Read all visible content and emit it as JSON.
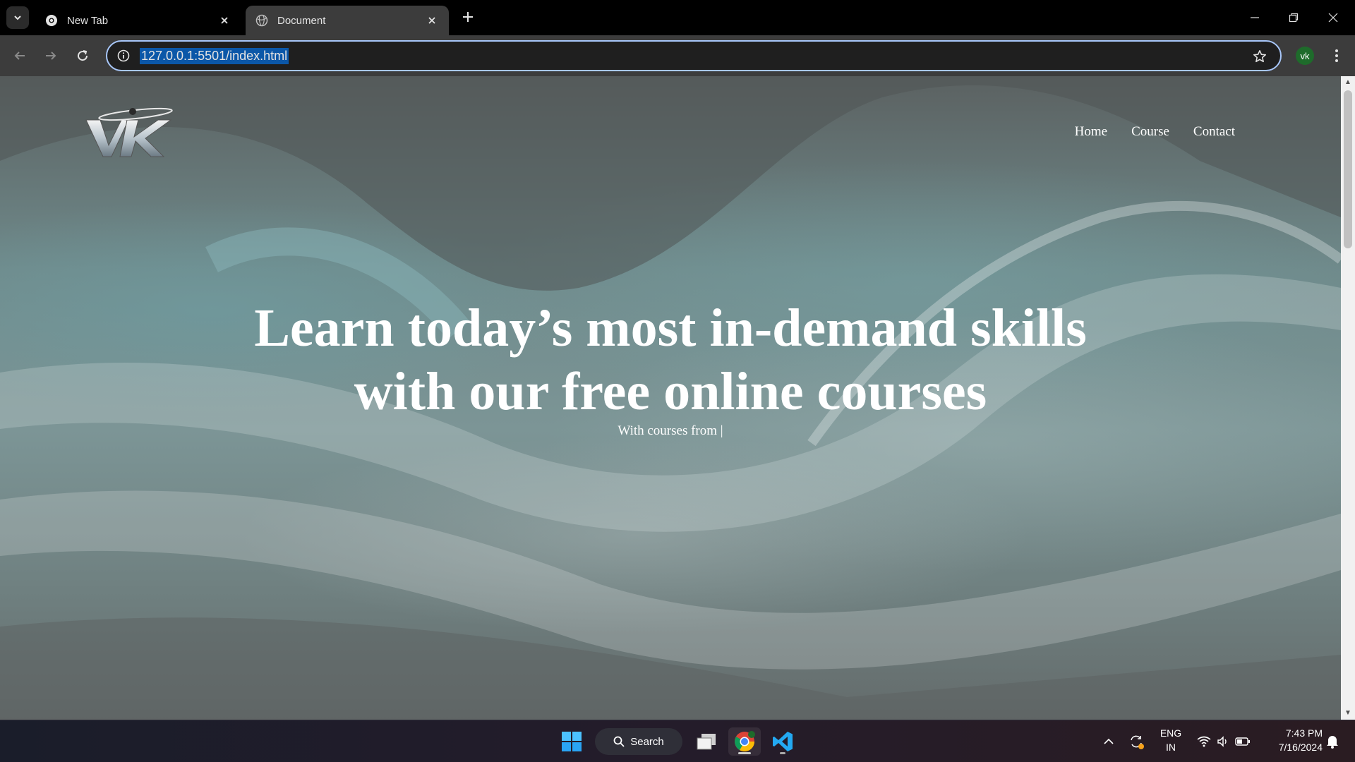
{
  "browser": {
    "tabs": [
      {
        "title": "New Tab",
        "active": false
      },
      {
        "title": "Document",
        "active": true
      }
    ],
    "address_url": "127.0.0.1:5501/index.html",
    "profile_initials": "vk"
  },
  "page": {
    "logo_text": "VK",
    "nav": [
      "Home",
      "Course",
      "Contact"
    ],
    "hero_title_line1": "Learn today’s most in-demand skills",
    "hero_title_line2": "with our free online courses",
    "hero_subtitle": "With courses from |"
  },
  "taskbar": {
    "search_label": "Search",
    "language_line1": "ENG",
    "language_line2": "IN",
    "time": "7:43 PM",
    "date": "7/16/2024"
  },
  "colors": {
    "accent_omnibox_border": "#a8c7fa",
    "url_selection": "#0b57a8",
    "profile_bg": "#1e6b2b"
  }
}
